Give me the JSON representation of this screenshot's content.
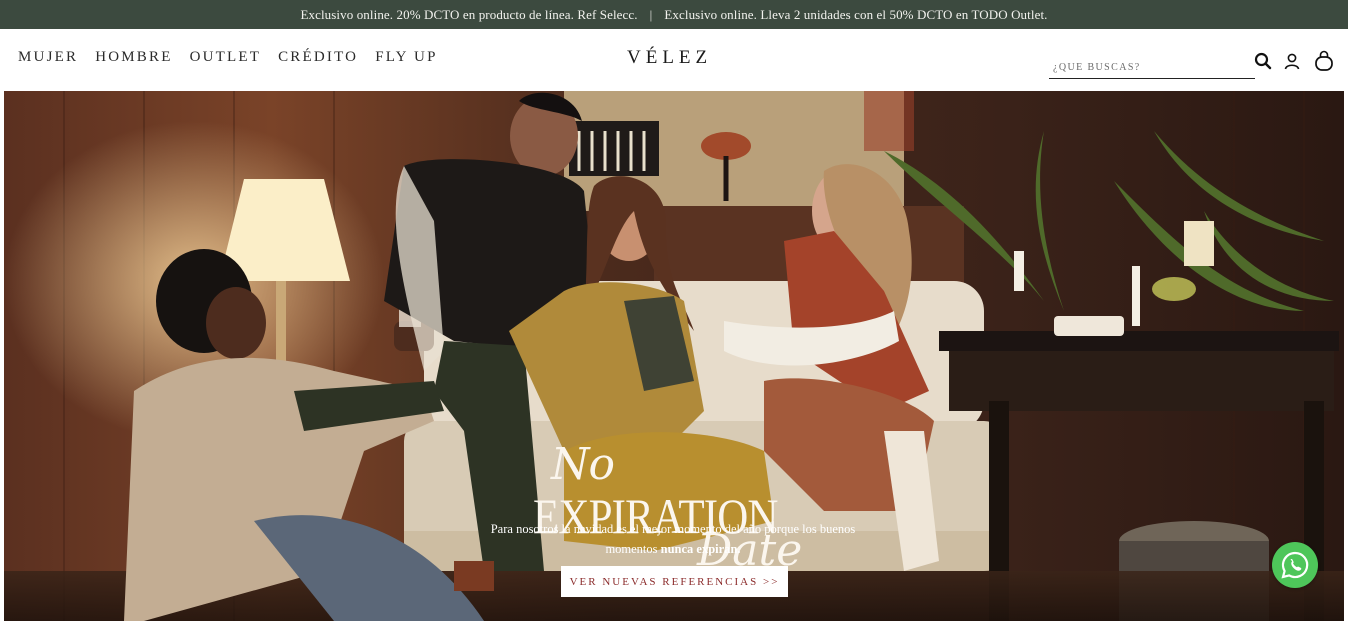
{
  "announcement": {
    "left": "Exclusivo online. 20% DCTO en producto de línea. Ref Selecc.",
    "separator": "|",
    "right": "Exclusivo online. Lleva 2 unidades con el 50% DCTO en TODO Outlet."
  },
  "nav": {
    "items": [
      "MUJER",
      "HOMBRE",
      "OUTLET",
      "CRÉDITO",
      "FLY UP"
    ]
  },
  "brand": {
    "logo": "VÉLEZ"
  },
  "search": {
    "placeholder": "¿QUE BUSCAS?",
    "value": ""
  },
  "icons": {
    "search": "search-icon",
    "account": "user-icon",
    "cart": "bag-icon",
    "whatsapp": "whatsapp-icon"
  },
  "hero": {
    "headline": {
      "line1": "No",
      "line2": "EXPIRATION",
      "line3": "Date"
    },
    "text_before": "Para nosotros la navidad es el mejor momento del año porque los buenos momentos",
    "text_bold": "nunca expiran.",
    "cta": "VER NUEVAS REFERENCIAS >>"
  },
  "colors": {
    "announcement_bg": "#3c4a3f",
    "cta_text": "#8b2b2b",
    "whatsapp": "#4ec65a"
  }
}
